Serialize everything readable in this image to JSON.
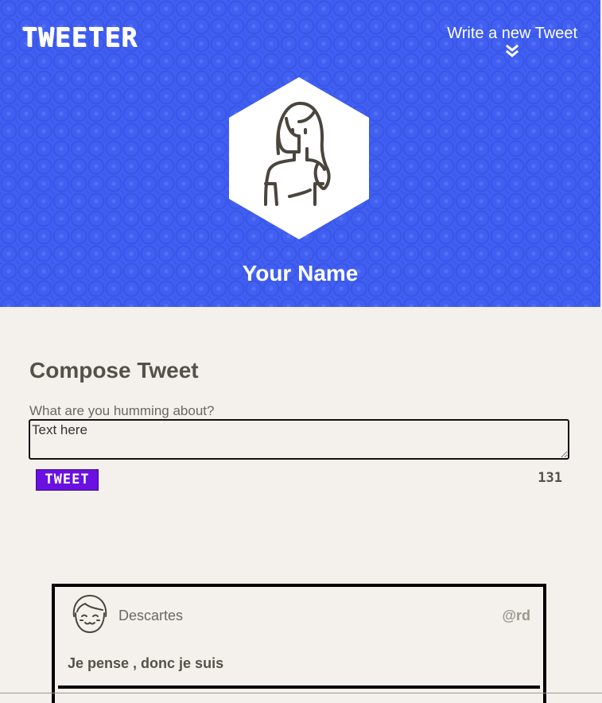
{
  "header": {
    "logo": "TWEETER",
    "write_link": "Write a new Tweet",
    "user_name": "Your Name",
    "icons": {
      "chevrons": "double-chevron-down-icon",
      "avatar": "profile-avatar-icon"
    },
    "colors": {
      "background": "#4160f2",
      "text": "#ffffff"
    }
  },
  "compose": {
    "title": "Compose Tweet",
    "label": "What are you humming about?",
    "textarea_value": "Text here",
    "tweet_button": "TWEET",
    "counter": "131",
    "colors": {
      "button": "#6a10e0"
    }
  },
  "tweets": [
    {
      "author": "Descartes",
      "handle": "@rd",
      "content": "Je pense , donc je suis",
      "avatar_icon": "smiling-face-avatar-icon"
    }
  ]
}
